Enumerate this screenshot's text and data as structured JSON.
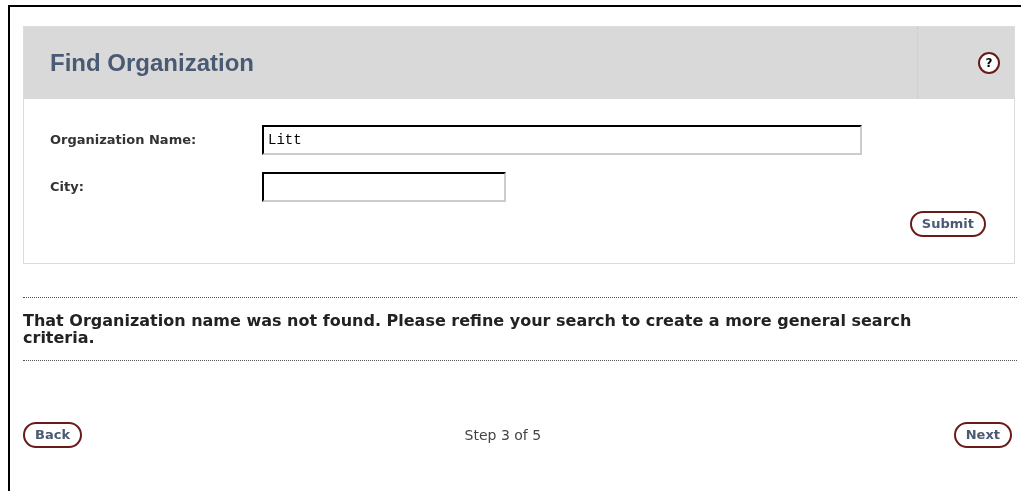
{
  "panel": {
    "title": "Find Organization",
    "help_icon": "?",
    "fields": [
      {
        "label": "Organization Name:",
        "value": "Litt"
      },
      {
        "label": "City:"
      }
    ],
    "submit": "Submit"
  },
  "message": "That Organization name was not found. Please refine your search to create a more general search criteria.",
  "footer": {
    "back": "Back",
    "step": "Step 3 of 5",
    "next": "Next"
  }
}
